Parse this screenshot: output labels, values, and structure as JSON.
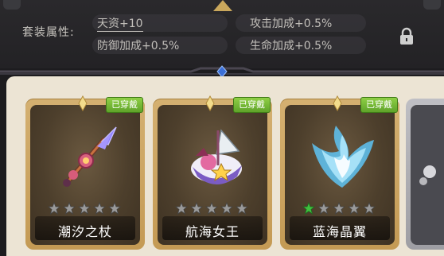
{
  "attributes": {
    "label": "套装属性:",
    "items": [
      {
        "text": "天资+10"
      },
      {
        "text": "攻击加成+0.5%"
      },
      {
        "text": "防御加成+0.5%"
      },
      {
        "text": "生命加成+0.5%"
      }
    ]
  },
  "cards": [
    {
      "name": "潮汐之杖",
      "badge": "已穿戴",
      "icon": "trident-staff-icon",
      "green_stars": 0,
      "total_stars": 5
    },
    {
      "name": "航海女王",
      "badge": "已穿戴",
      "icon": "sea-queen-ship-icon",
      "green_stars": 0,
      "total_stars": 5
    },
    {
      "name": "蓝海晶翼",
      "badge": "已穿戴",
      "icon": "crystal-wing-icon",
      "green_stars": 1,
      "total_stars": 5
    }
  ],
  "colors": {
    "badge_green": "#6fb634",
    "card_gold": "#c9a660",
    "panel_bg": "#242326",
    "star_green": "#3fbf3f",
    "star_grey": "#9a9a9a"
  }
}
